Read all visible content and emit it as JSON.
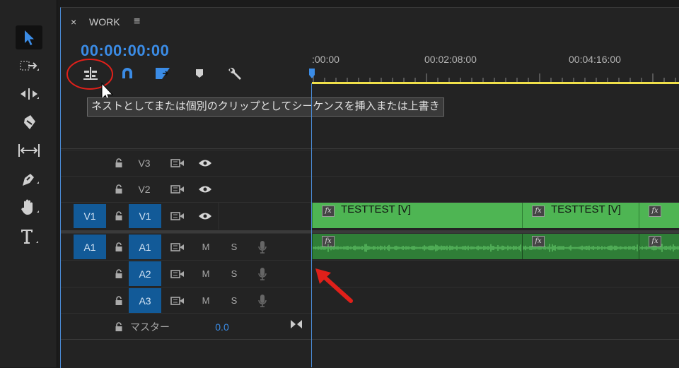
{
  "panel": {
    "title": "WORK",
    "close_label": "×",
    "menu_label": "≡"
  },
  "timecode": "00:00:00:00",
  "ruler": {
    "labels": [
      ":00:00",
      "00:02:08:00",
      "00:04:16:00"
    ]
  },
  "tooltip": "ネストとしてまたは個別のクリップとしてシーケンスを挿入または上書き",
  "toolbar": {
    "tools": [
      "selection-icon",
      "track-select-icon",
      "ripple-edit-icon",
      "razor-icon",
      "slip-icon",
      "pen-icon",
      "hand-icon",
      "type-icon"
    ]
  },
  "timeline_tools": [
    "insert-overwrite-sequence-icon",
    "snap-magnet-icon",
    "linked-selection-icon",
    "add-marker-icon",
    "wrench-icon"
  ],
  "tracks": {
    "video": [
      {
        "name": "V3",
        "source": "",
        "active": false
      },
      {
        "name": "V2",
        "source": "",
        "active": false
      },
      {
        "name": "V1",
        "source": "V1",
        "active": true
      }
    ],
    "audio": [
      {
        "name": "A1",
        "source": "A1",
        "active": true,
        "m": "M",
        "s": "S"
      },
      {
        "name": "A2",
        "source": "",
        "active": true,
        "m": "M",
        "s": "S"
      },
      {
        "name": "A3",
        "source": "",
        "active": true,
        "m": "M",
        "s": "S"
      }
    ],
    "master": {
      "label": "マスター",
      "value": "0.0"
    }
  },
  "clips": {
    "video": [
      "TESTTEST [V]",
      "TESTTEST [V]"
    ],
    "fx_label": "fx"
  },
  "colors": {
    "accent": "#3b8ce6",
    "clip_video": "#4eb553",
    "clip_audio": "#2f7e37",
    "work_area": "#f0e04a",
    "annotation": "#e0201a"
  }
}
